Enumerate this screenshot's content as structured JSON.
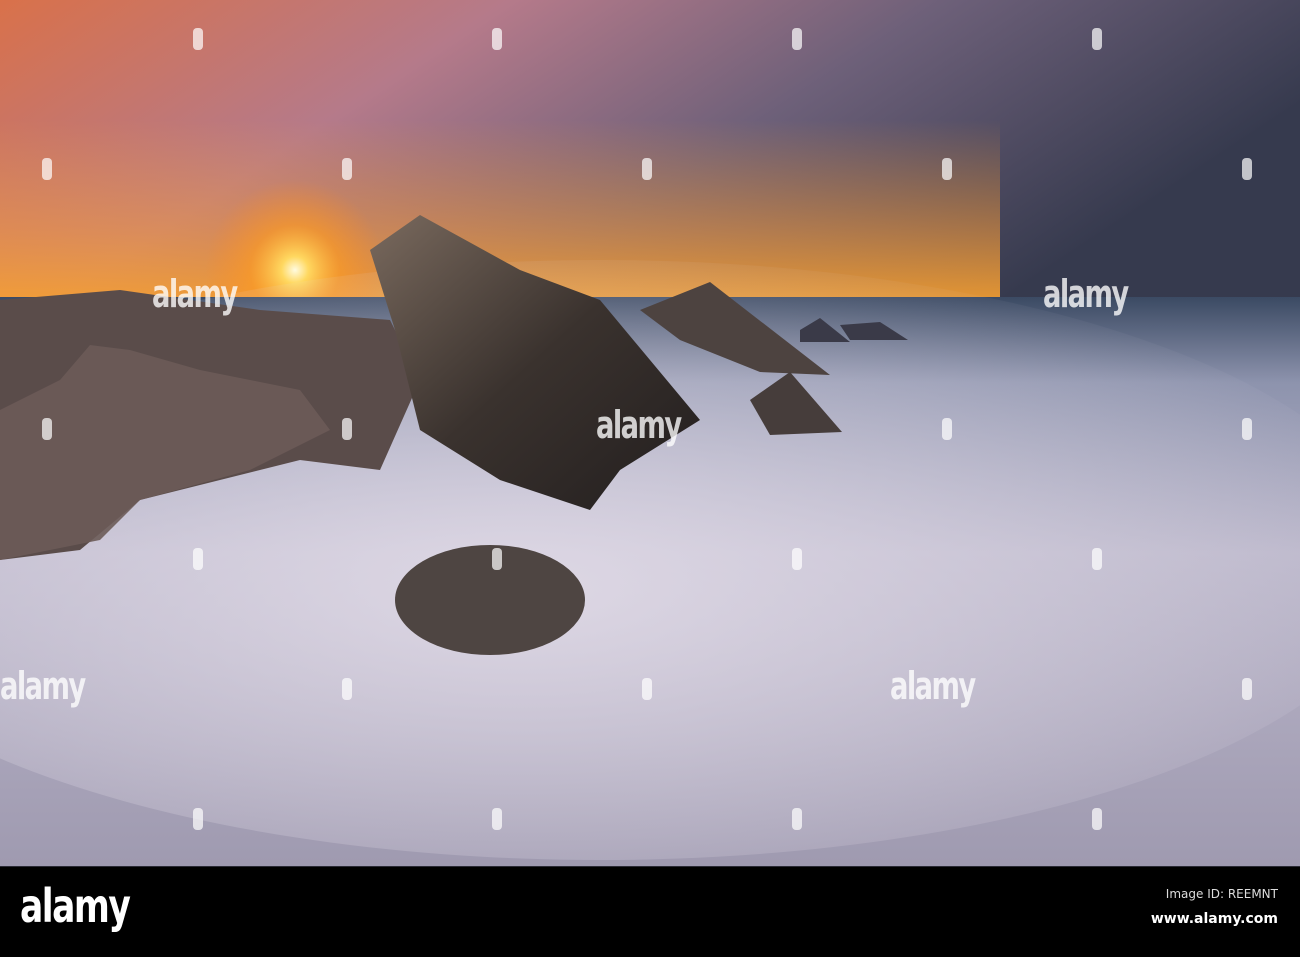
{
  "image": {
    "description_colors": {
      "sky_warm": "#f08a2a",
      "sky_cool": "#3c3f55",
      "mist": "#c9c4d6",
      "rock": "#3a3330"
    }
  },
  "watermark": {
    "text": "alamy"
  },
  "footer": {
    "logo": "alamy",
    "image_id": "Image ID: REEMNT",
    "url": "www.alamy.com"
  }
}
